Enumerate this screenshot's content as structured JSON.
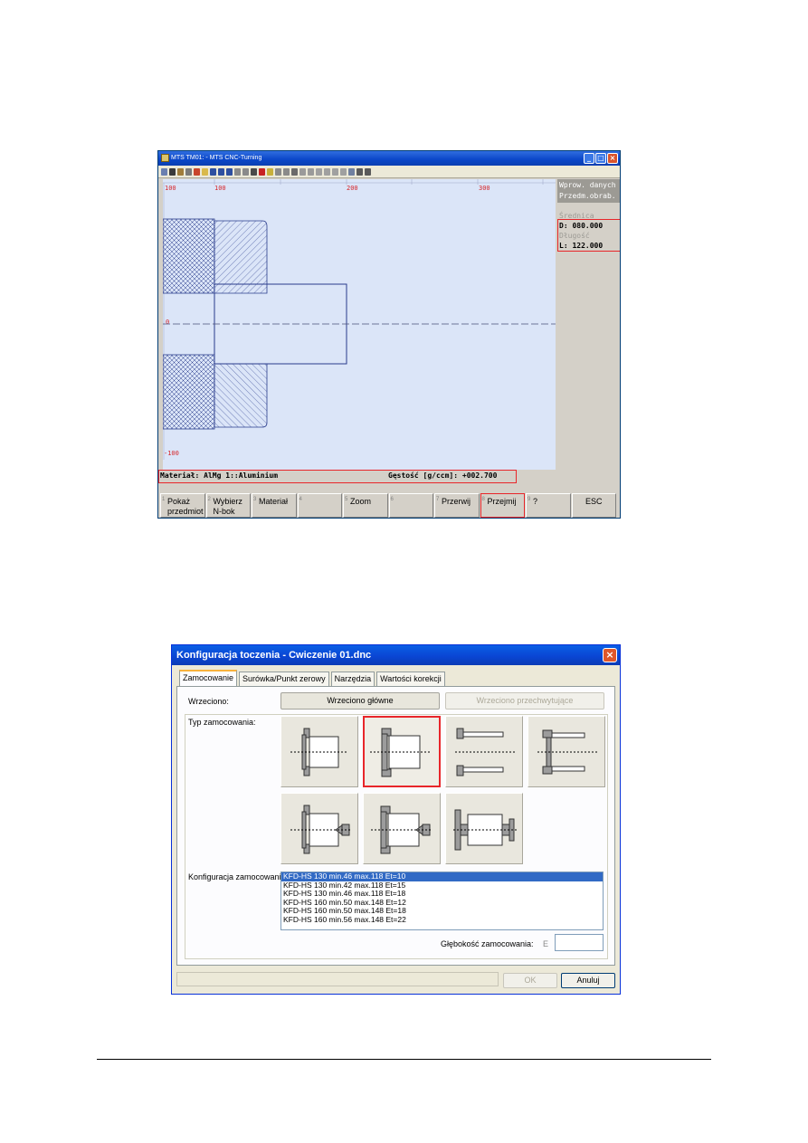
{
  "mts_window": {
    "title": "MTS TM01: - MTS CNC-Turning",
    "scale_labels": [
      "100",
      "100",
      "200",
      "300"
    ],
    "zero_label": "0",
    "bottom_label": "-100",
    "side_header": "Wprow. danych\nPrzedm.obrab.",
    "srednica_label": "Średnica",
    "d_value": "D: 080.000",
    "dlugosc_label": "Długość",
    "l_value": "L: 122.000",
    "material_text": "Materiał: AlMg 1::Aluminium",
    "density_text": "Gęstość [g/ccm]: +002.700",
    "fkeys": [
      {
        "num": "1",
        "label": "Pokaż przedmiot"
      },
      {
        "num": "2",
        "label": "Wybierz N-bok"
      },
      {
        "num": "3",
        "label": "Materiał"
      },
      {
        "num": "4",
        "label": ""
      },
      {
        "num": "5",
        "label": "Zoom"
      },
      {
        "num": "6",
        "label": ""
      },
      {
        "num": "7",
        "label": "Przerwij"
      },
      {
        "num": "8",
        "label": "Przejmij"
      },
      {
        "num": "9",
        "label": "?"
      },
      {
        "num": "",
        "label": "ESC"
      }
    ],
    "colors": {
      "canvas": "#dbe5f8",
      "highlight": "#e8262a",
      "part_outline": "#2a3c8c",
      "scale": "#d6262a"
    }
  },
  "dialog": {
    "title": "Konfiguracja toczenia - Cwiczenie 01.dnc",
    "tabs": [
      "Zamocowanie",
      "Surówka/Punkt zerowy",
      "Narzędzia",
      "Wartości korekcji"
    ],
    "wrzeciono_label": "Wrzeciono:",
    "spindle_main": "Wrzeciono główne",
    "spindle_sub": "Wrzeciono przechwytujące",
    "typ_label": "Typ zamocowania:",
    "konfig_label": "Konfiguracja zamocowania:",
    "configs": [
      "KFD-HS 130 min.46 max.118 Et=10",
      "KFD-HS 130 min.42 max.118 Et=15",
      "KFD-HS 130 min.46 max.118 Et=18",
      "KFD-HS 160 min.50 max.148 Et=12",
      "KFD-HS 160 min.50 max.148 Et=18",
      "KFD-HS 160 min.56 max.148 Et=22"
    ],
    "depth_label": "Głębokość zamocowania:",
    "depth_symbol": "E",
    "depth_value": "",
    "ok_label": "OK",
    "cancel_label": "Anuluj"
  }
}
